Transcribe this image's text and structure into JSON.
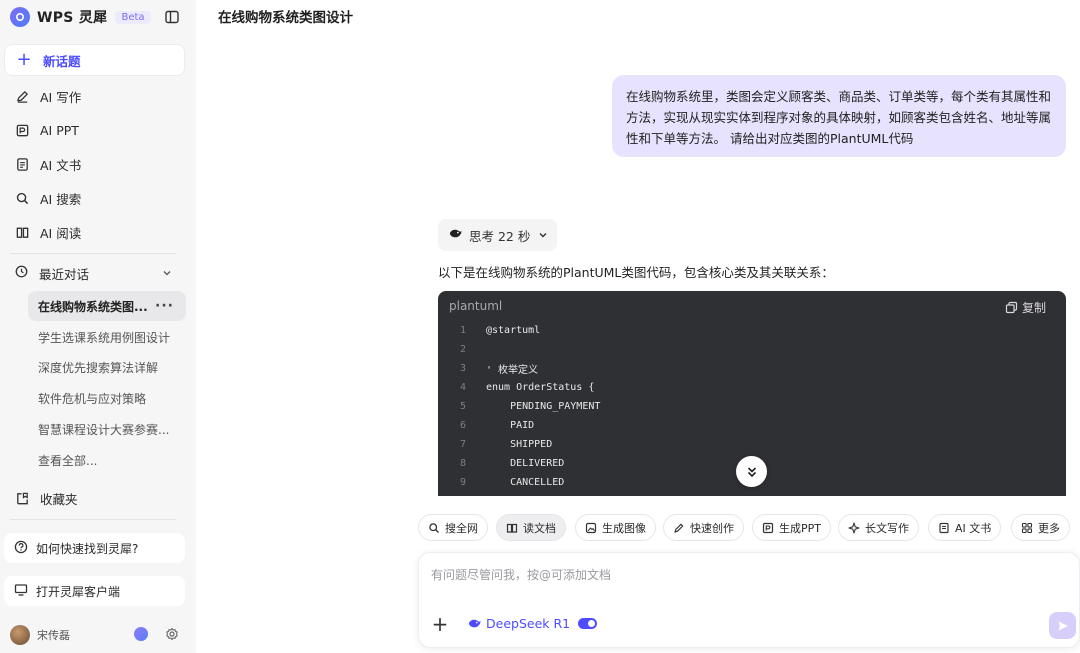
{
  "brand": {
    "name": "WPS 灵犀",
    "badge": "Beta"
  },
  "sidebar": {
    "new_chat": "新话题",
    "nav": [
      {
        "label": "AI 写作",
        "icon": "pen-icon"
      },
      {
        "label": "AI PPT",
        "icon": "ppt-icon"
      },
      {
        "label": "AI 文书",
        "icon": "document-icon"
      },
      {
        "label": "AI 搜索",
        "icon": "search-icon"
      },
      {
        "label": "AI 阅读",
        "icon": "book-icon"
      }
    ],
    "recent": {
      "title": "最近对话",
      "items": [
        "在线购物系统类图...",
        "学生选课系统用例图设计",
        "深度优先搜索算法详解",
        "软件危机与应对策略",
        "智慧课程设计大赛参赛...",
        "查看全部..."
      ]
    },
    "favorites": "收藏夹",
    "help": "如何快速找到灵犀?",
    "open_client": "打开灵犀客户端",
    "user_name": "宋传磊"
  },
  "chat": {
    "title": "在线购物系统类图设计",
    "user_message": "在线购物系统里，类图会定义顾客类、商品类、订单类等，每个类有其属性和方法，实现从现实实体到程序对象的具体映射，如顾客类包含姓名、地址等属性和下单等方法。 请给出对应类图的PlantUML代码",
    "thinking": "思考 22 秒",
    "answer_intro": "以下是在线购物系统的PlantUML类图代码，包含核心类及其关联关系：",
    "code": {
      "language": "plantuml",
      "copy_label": "复制",
      "lines": [
        {
          "n": "1",
          "text": "@startuml"
        },
        {
          "n": "2",
          "text": ""
        },
        {
          "n": "3",
          "text": "' 枚举定义"
        },
        {
          "n": "4",
          "text": "enum OrderStatus {"
        },
        {
          "n": "5",
          "text": "    PENDING_PAYMENT"
        },
        {
          "n": "6",
          "text": "    PAID"
        },
        {
          "n": "7",
          "text": "    SHIPPED"
        },
        {
          "n": "8",
          "text": "    DELIVERED"
        },
        {
          "n": "9",
          "text": "    CANCELLED"
        }
      ]
    }
  },
  "tools": [
    {
      "label": "搜全网",
      "icon": "search-icon"
    },
    {
      "label": "读文档",
      "icon": "read-doc-icon"
    },
    {
      "label": "生成图像",
      "icon": "image-icon"
    },
    {
      "label": "快速创作",
      "icon": "create-icon"
    },
    {
      "label": "生成PPT",
      "icon": "ppt-icon"
    },
    {
      "label": "长文写作",
      "icon": "sparkle-icon"
    },
    {
      "label": "AI 文书",
      "icon": "document-icon"
    },
    {
      "label": "更多",
      "icon": "grid-icon"
    }
  ],
  "input": {
    "placeholder": "有问题尽管问我，按@可添加文档",
    "model": "DeepSeek R1"
  },
  "colors": {
    "accent": "#4d4dff",
    "user_bubble": "#e7e2fd",
    "code_bg": "#2f3033",
    "sidebar_bg": "#f6f6f7"
  }
}
